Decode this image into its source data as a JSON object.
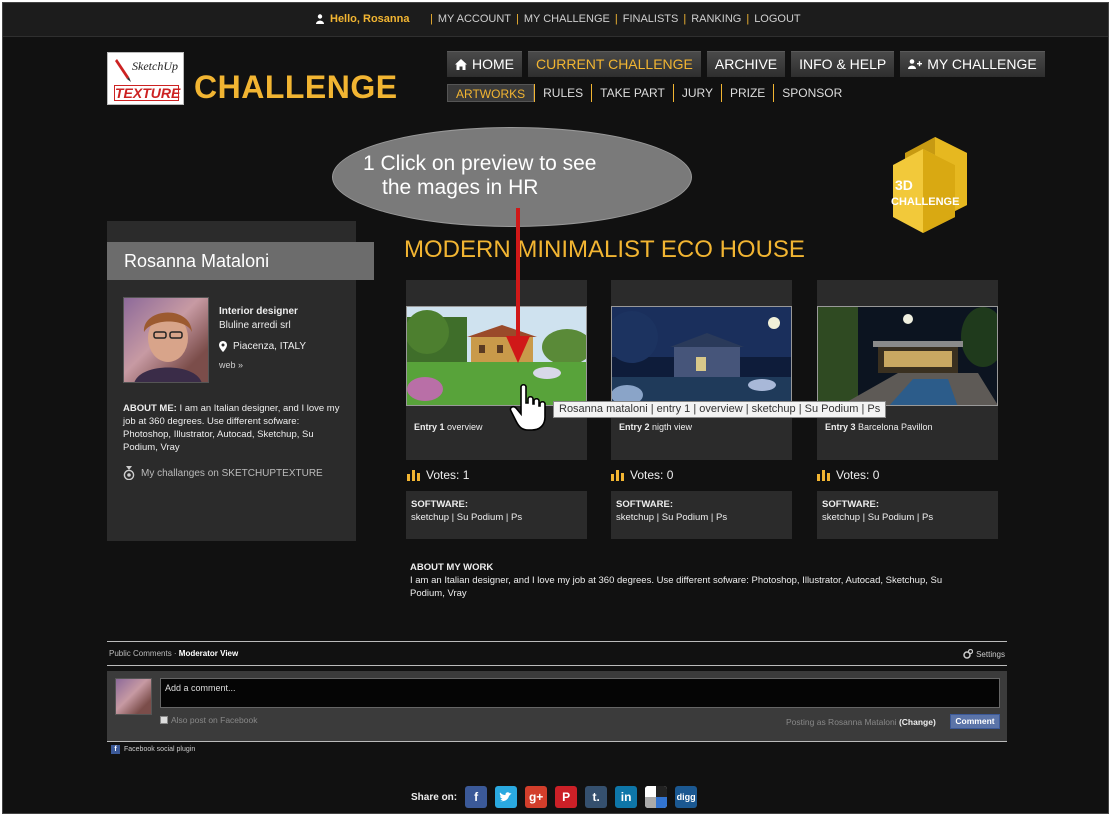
{
  "user_bar": {
    "greeting": "Hello, Rosanna",
    "links": [
      "MY ACCOUNT",
      "MY CHALLENGE",
      "FINALISTS",
      "RANKING",
      "LOGOUT"
    ]
  },
  "logo": {
    "sketchup": "SketchUp",
    "texture": "TEXTURE",
    "title": "CHALLENGE"
  },
  "main_nav": [
    {
      "label": "HOME",
      "icon": "home-icon",
      "active": false
    },
    {
      "label": "CURRENT CHALLENGE",
      "icon": "",
      "active": true
    },
    {
      "label": "ARCHIVE",
      "icon": "",
      "active": false
    },
    {
      "label": "INFO & HELP",
      "icon": "",
      "active": false
    },
    {
      "label": "MY CHALLENGE",
      "icon": "add-user-icon",
      "active": false
    }
  ],
  "sub_nav": [
    {
      "label": "ARTWORKS",
      "active": true
    },
    {
      "label": "RULES",
      "active": false
    },
    {
      "label": "TAKE PART",
      "active": false
    },
    {
      "label": "JURY",
      "active": false
    },
    {
      "label": "PRIZE",
      "active": false
    },
    {
      "label": "SPONSOR",
      "active": false
    }
  ],
  "annotation": {
    "line1": "1 Click on preview to see",
    "line2": "the mages in HR"
  },
  "badge": {
    "line1": "3D",
    "line2": "CHALLENGE"
  },
  "profile": {
    "name": "Rosanna Mataloni",
    "role": "Interior designer",
    "company": "Bluline arredi srl",
    "location": "Piacenza, ITALY",
    "web": "web »",
    "about_label": "ABOUT ME:",
    "about_text": " I am an Italian designer, and I love my job at 360 degrees. Use different sofware: Photoshop, Illustrator, Autocad, Sketchup, Su Podium, Vray",
    "my_challenges": "My challanges on SKETCHUPTEXTURE"
  },
  "artwork_title": "MODERN MINIMALIST ECO HOUSE",
  "entries": [
    {
      "label": "Entry 1",
      "desc": " overview",
      "votes": "Votes: 1",
      "software_label": "SOFTWARE:",
      "software": "sketchup | Su Podium | Ps"
    },
    {
      "label": "Entry 2",
      "desc": " nigth view",
      "votes": "Votes: 0",
      "software_label": "SOFTWARE:",
      "software": "sketchup | Su Podium | Ps"
    },
    {
      "label": "Entry 3",
      "desc": " Barcelona Pavillon",
      "votes": "Votes: 0",
      "software_label": "SOFTWARE:",
      "software": "sketchup | Su Podium | Ps"
    }
  ],
  "tooltip": "Rosanna mataloni | entry 1 | overview | sketchup | Su Podium | Ps",
  "about_work": {
    "heading": "ABOUT MY WORK",
    "text": "I am an Italian designer, and I love my job at 360 degrees. Use different sofware: Photoshop, Illustrator, Autocad, Sketchup, Su Podium, Vray"
  },
  "comments": {
    "tab_public": "Public Comments",
    "tab_sep": " · ",
    "tab_moderator": "Moderator View",
    "settings": "Settings",
    "placeholder": "Add a comment...",
    "also_post": "Also post on Facebook",
    "posting_as": "Posting as Rosanna Mataloni",
    "change": "(Change)",
    "button": "Comment",
    "plugin": "Facebook social plugin"
  },
  "share": {
    "label": "Share on:",
    "services": [
      {
        "name": "facebook",
        "glyph": "f",
        "color": "#3b5998"
      },
      {
        "name": "twitter",
        "glyph": "t",
        "color": "#2aa9e0"
      },
      {
        "name": "google-plus",
        "glyph": "g+",
        "color": "#d23e2b"
      },
      {
        "name": "pinterest",
        "glyph": "P",
        "color": "#cb2027"
      },
      {
        "name": "tumblr",
        "glyph": "t.",
        "color": "#35506e"
      },
      {
        "name": "linkedin",
        "glyph": "in",
        "color": "#0e76a8"
      },
      {
        "name": "delicious",
        "glyph": "",
        "color": "#ffffff"
      },
      {
        "name": "digg",
        "glyph": "digg",
        "color": "#1b5891"
      }
    ]
  },
  "colors": {
    "accent": "#f2b532",
    "background": "#111111",
    "panel": "#2b2b2b"
  }
}
